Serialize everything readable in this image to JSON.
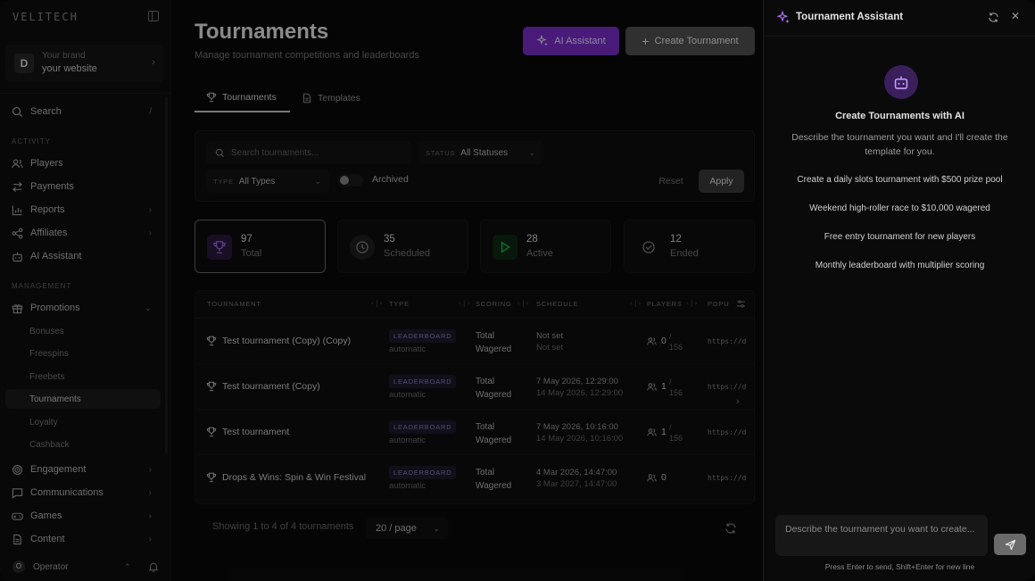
{
  "sidebar": {
    "logo": "VELITECH",
    "brand": {
      "avatar": "D",
      "line1": "Your brand",
      "line2": "your website"
    },
    "search": {
      "label": "Search",
      "shortcut": "/"
    },
    "sections": {
      "activity": "ACTIVITY",
      "management": "MANAGEMENT"
    },
    "activity_items": [
      {
        "label": "Players",
        "icon": "users-icon"
      },
      {
        "label": "Payments",
        "icon": "arrows-icon"
      },
      {
        "label": "Reports",
        "icon": "bar-chart-icon"
      },
      {
        "label": "Affiliates",
        "icon": "share-icon"
      },
      {
        "label": "AI Assistant",
        "icon": "bot-icon"
      }
    ],
    "promotions": {
      "label": "Promotions",
      "icon": "gift-icon"
    },
    "promotion_sub": [
      "Bonuses",
      "Freespins",
      "Freebets",
      "Tournaments",
      "Loyalty",
      "Cashback"
    ],
    "active_sub": "Tournaments",
    "other_items": [
      {
        "label": "Engagement",
        "icon": "target-icon"
      },
      {
        "label": "Communications",
        "icon": "message-icon"
      },
      {
        "label": "Games",
        "icon": "gamepad-icon"
      },
      {
        "label": "Content",
        "icon": "file-icon"
      }
    ],
    "operator": {
      "avatar": "O",
      "label": "Operator"
    }
  },
  "header": {
    "title": "Tournaments",
    "subtitle": "Manage tournament competitions and leaderboards",
    "ai_button": "AI Assistant",
    "create_button": "Create Tournament"
  },
  "tabs": [
    {
      "label": "Tournaments"
    },
    {
      "label": "Templates"
    }
  ],
  "filters": {
    "search_placeholder": "Search tournaments...",
    "status_label": "STATUS",
    "status_value": "All Statuses",
    "type_label": "TYPE",
    "type_value": "All Types",
    "archived_label": "Archived",
    "archived_on": false,
    "reset": "Reset",
    "apply": "Apply"
  },
  "stats": [
    {
      "value": "97",
      "label": "Total",
      "color": "#7e2fd1"
    },
    {
      "value": "35",
      "label": "Scheduled",
      "color": "#8a8a8a"
    },
    {
      "value": "28",
      "label": "Active",
      "color": "#22c55e"
    },
    {
      "value": "12",
      "label": "Ended",
      "color": "#8a8a8a"
    }
  ],
  "table": {
    "columns": [
      "TOURNAMENT",
      "TYPE",
      "SCORING",
      "SCHEDULE",
      "PLAYERS",
      "POPU"
    ],
    "rows": [
      {
        "name": "Test tournament (Copy) (Copy)",
        "type": "LEADERBOARD",
        "type_sub": "automatic",
        "scoring1": "Total",
        "scoring2": "Wagered",
        "sched1": "Not set",
        "sched2": "Not set",
        "players": "0",
        "max1": "/",
        "max2": "156",
        "popu": "https://d"
      },
      {
        "name": "Test tournament (Copy)",
        "type": "LEADERBOARD",
        "type_sub": "automatic",
        "scoring1": "Total",
        "scoring2": "Wagered",
        "sched1": "7 May 2026, 12:29:00",
        "sched2": "14 May 2026, 12:29:00",
        "players": "1",
        "max1": "/",
        "max2": "156",
        "popu": "https://d"
      },
      {
        "name": "Test tournament",
        "type": "LEADERBOARD",
        "type_sub": "automatic",
        "scoring1": "Total",
        "scoring2": "Wagered",
        "sched1": "7 May 2026, 10:16:00",
        "sched2": "14 May 2026, 10:16:00",
        "players": "1",
        "max1": "/",
        "max2": "156",
        "popu": "https://d"
      },
      {
        "name": "Drops & Wins: Spin & Win Festival",
        "type": "LEADERBOARD",
        "type_sub": "automatic",
        "scoring1": "Total",
        "scoring2": "Wagered",
        "sched1": "4 Mar 2026, 14:47:00",
        "sched2": "3 Mar 2027, 14:47:00",
        "players": "0",
        "max1": "",
        "max2": "",
        "popu": "https://d"
      }
    ]
  },
  "footer": {
    "showing": "Showing 1 to 4 of 4 tournaments",
    "page_size": "20 / page"
  },
  "assistant": {
    "title": "Tournament Assistant",
    "heading": "Create Tournaments with AI",
    "description": "Describe the tournament you want and I'll create the template for you.",
    "suggestions": [
      "Create a daily slots tournament with $500 prize pool",
      "Weekend high-roller race to $10,000 wagered",
      "Free entry tournament for new players",
      "Monthly leaderboard with multiplier scoring"
    ],
    "input_placeholder": "Describe the tournament you want to create...",
    "hint": "Press Enter to send, Shift+Enter for new line",
    "accent": "#7e2fd1"
  }
}
